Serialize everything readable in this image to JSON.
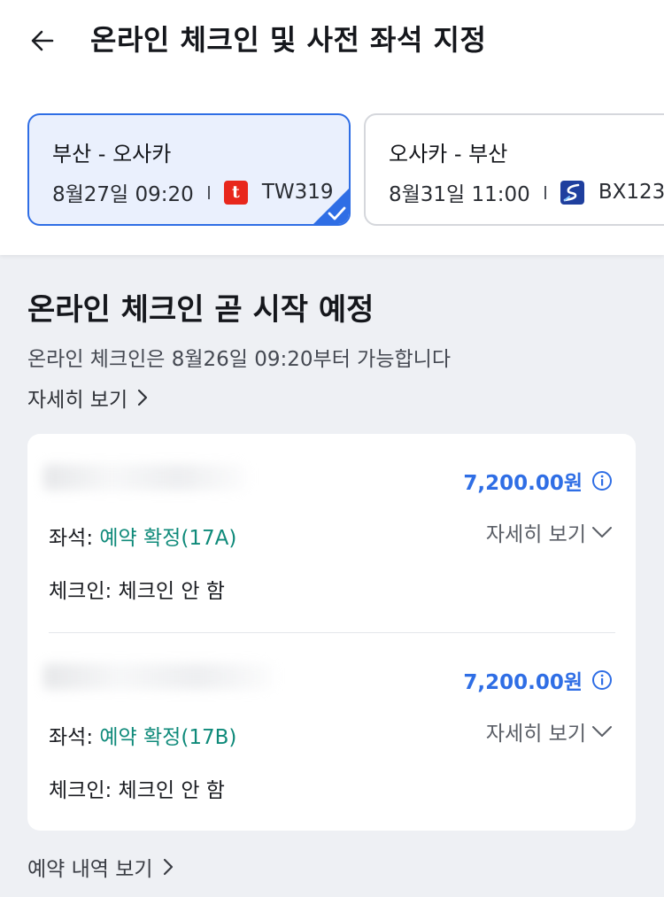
{
  "header": {
    "title": "온라인 체크인 및 사전 좌석 지정"
  },
  "flights": [
    {
      "route": "부산 - 오사카",
      "datetime": "8월27일 09:20",
      "airline_icon": "tway-logo",
      "flight_no": "TW319",
      "selected": true
    },
    {
      "route": "오사카 - 부산",
      "datetime": "8월31일 11:00",
      "airline_icon": "air-busan-logo",
      "flight_no": "BX123",
      "selected": false
    }
  ],
  "checkin": {
    "title": "온라인 체크인 곧 시작 예정",
    "subtitle": "온라인 체크인은 8월26일 09:20부터 가능합니다",
    "detail_link": "자세히 보기"
  },
  "passengers": [
    {
      "price": "7,200.00원",
      "seat_label": "좌석:",
      "seat_status": "예약 확정(17A)",
      "detail_toggle": "자세히 보기",
      "checkin_status": "체크인: 체크인 안 함"
    },
    {
      "price": "7,200.00원",
      "seat_label": "좌석:",
      "seat_status": "예약 확정(17B)",
      "detail_toggle": "자세히 보기",
      "checkin_status": "체크인: 체크인 안 함"
    }
  ],
  "footer": {
    "booking_link": "예약 내역 보기"
  },
  "colors": {
    "accent_blue": "#2f6ee5",
    "seat_green": "#0f8a7a",
    "background": "#eef0f4"
  }
}
